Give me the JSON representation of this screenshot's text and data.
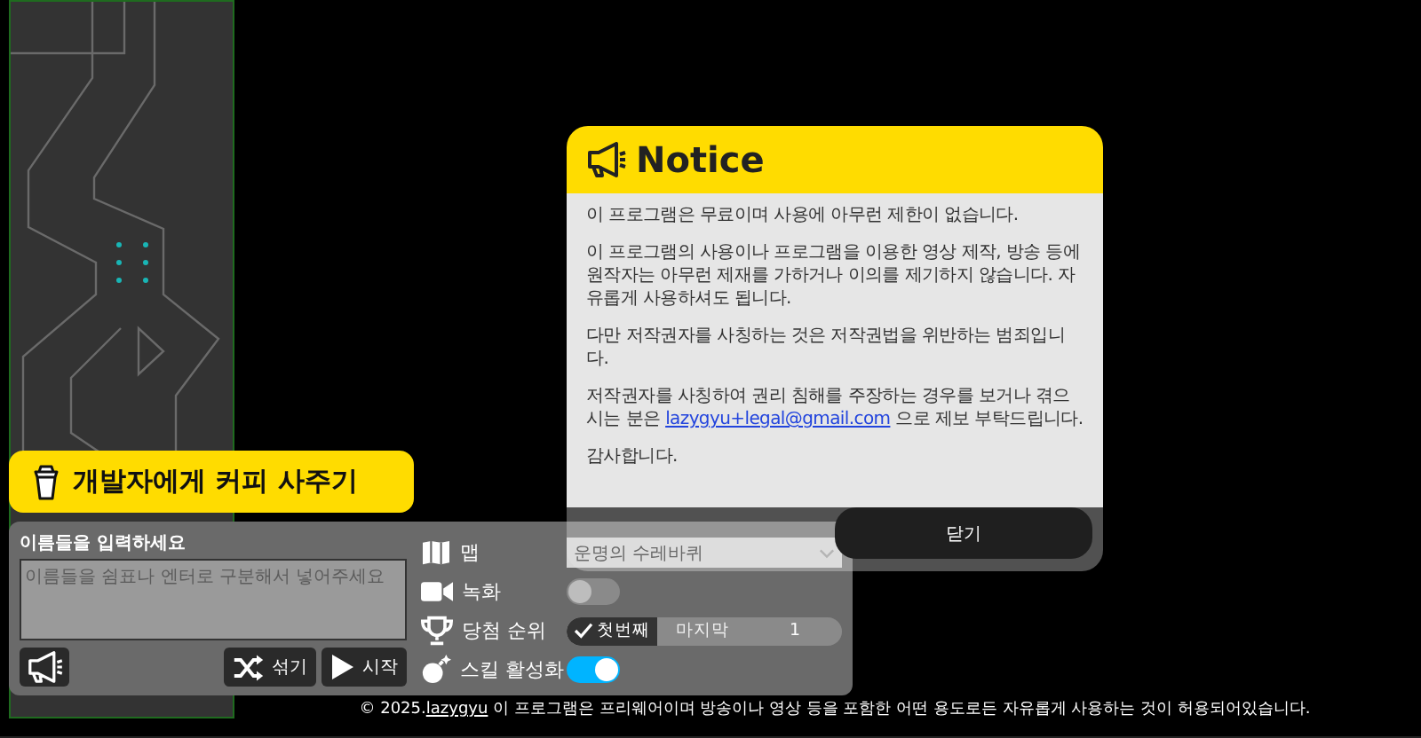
{
  "coffee_button": {
    "label": "개발자에게 커피 사주기"
  },
  "names": {
    "label": "이름들을 입력하세요",
    "placeholder": "이름들을 쉼표나 엔터로 구분해서 넣어주세요"
  },
  "buttons": [
    {
      "kind": "notice"
    },
    {
      "kind": "shuffle",
      "label": "섞기"
    },
    {
      "kind": "start",
      "label": "시작"
    }
  ],
  "map": {
    "label": "맵",
    "value": "운명의 수레바퀴"
  },
  "recording": {
    "label": "녹화",
    "on": false
  },
  "rank": {
    "label": "당첨 순위",
    "options": [
      {
        "label": "첫번째",
        "selected": true
      },
      {
        "label": "마지막",
        "selected": false
      }
    ],
    "count": "1"
  },
  "skill": {
    "label": "스킬 활성화",
    "on": true
  },
  "notice": {
    "title": "Notice",
    "paragraphs": [
      {
        "text": "이 프로그램은 무료이며 사용에 아무런 제한이 없습니다."
      },
      {
        "text": "이 프로그램의 사용이나 프로그램을 이용한 영상 제작, 방송 등에 원작자는 아무런 제재를 가하거나 이의를 제기하지 않습니다. 자유롭게 사용하셔도 됩니다."
      },
      {
        "text": "다만 저작권자를 사칭하는 것은 저작권법을 위반하는 범죄입니다."
      },
      {
        "text": "저작권자를 사칭하여 권리 침해를 주장하는 경우를 보거나 겪으시는 분은 ",
        "link": "lazygyu+legal@gmail.com",
        "after": " 으로 제보 부탁드립니다."
      },
      {
        "text": "감사합니다."
      }
    ],
    "close": "닫기"
  },
  "footer": {
    "prefix": "© 2025.",
    "link": "lazygyu",
    "text": " 이 프로그램은 프리웨어이며 방송이나 영상 등을 포함한 어떤 용도로든 자유롭게 사용하는 것이 허용되어있습니다."
  }
}
